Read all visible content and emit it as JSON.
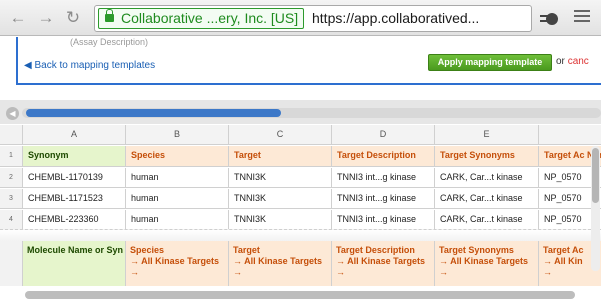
{
  "browser": {
    "ev_label": "Collaborative ...ery, Inc. [US]",
    "url": "https://app.collaboratived...",
    "icons": {
      "back": "back-arrow-icon",
      "forward": "forward-arrow-icon",
      "reload": "reload-icon",
      "star": "star-icon",
      "menu": "menu-icon"
    }
  },
  "page": {
    "faded_text": "(Assay Description)",
    "back_link": "Back to mapping templates",
    "apply_button": "Apply mapping template",
    "or_text": "or",
    "cancel_text": "canc"
  },
  "grid": {
    "column_letters": [
      "A",
      "B",
      "C",
      "D",
      "E",
      ""
    ],
    "rows": [
      {
        "num": "1",
        "cells": [
          "Synonym",
          "Species",
          "Target",
          "Target Description",
          "Target Synonyms",
          "Target Ac Numbers"
        ]
      },
      {
        "num": "2",
        "cells": [
          "CHEMBL-1170139",
          "human",
          "TNNI3K",
          "TNNI3 int...g kinase",
          "CARK, Car...t kinase",
          "NP_0570"
        ]
      },
      {
        "num": "3",
        "cells": [
          "CHEMBL-1171523",
          "human",
          "TNNI3K",
          "TNNI3 int...g kinase",
          "CARK, Car...t kinase",
          "NP_0570"
        ]
      },
      {
        "num": "4",
        "cells": [
          "CHEMBL-223360",
          "human",
          "TNNI3K",
          "TNNI3 int...g kinase",
          "CARK, Car...t kinase",
          "NP_0570"
        ]
      }
    ],
    "mapping": [
      {
        "line1": "Molecule Name or Syn",
        "line2": "",
        "line3": ""
      },
      {
        "line1": "Species",
        "line2": "→ All Kinase Targets",
        "line3": "→"
      },
      {
        "line1": "Target",
        "line2": "→ All Kinase Targets",
        "line3": "→"
      },
      {
        "line1": "Target Description",
        "line2": "→ All Kinase Targets",
        "line3": "→"
      },
      {
        "line1": "Target Synonyms",
        "line2": "→ All Kinase Targets",
        "line3": "→"
      },
      {
        "line1": "Target Ac",
        "line2": "→ All Kin",
        "line3": "→"
      }
    ]
  },
  "colors": {
    "accent_blue": "#2d6fd0",
    "apply_green": "#4a9a1e",
    "green_header": "#e6f5cc",
    "orange_header": "#fde9d6",
    "orange_text": "#c54f0a"
  }
}
